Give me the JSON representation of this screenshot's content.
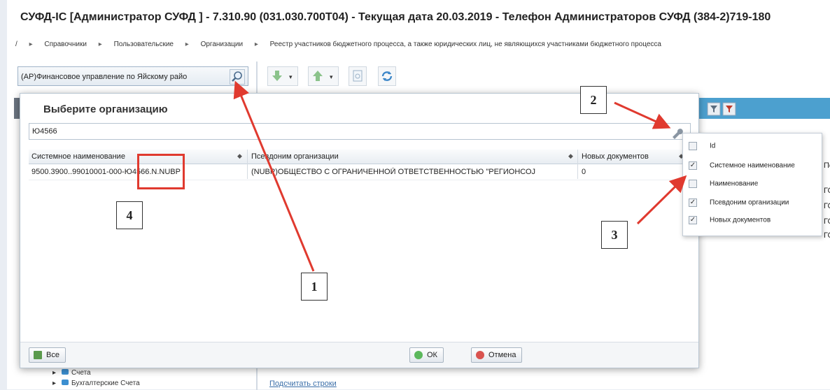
{
  "app": {
    "title": "СУФД-IC [Администратор СУФД ] - 7.310.90 (031.030.700Т04) - Текущая дата 20.03.2019 - Телефон Администраторов СУФД (384-2)719-180",
    "breadcrumb": [
      "/",
      "Справочники",
      "Пользовательские",
      "Организации",
      "Реестр участников бюджетного процесса, а также юридических лиц, не являющихся участниками бюджетного процесса"
    ],
    "org_selector_value": "(АР)Финансовое управление по Яйскому райо",
    "bottom_link": "Подсчитать строки",
    "tree_items": [
      "Счета",
      "Бухгалтерские Счета"
    ],
    "right_grid_cells": [
      "Пс",
      "ГС",
      "ГС",
      "ГС",
      "ГС"
    ]
  },
  "dialog": {
    "title": "Выберите организацию",
    "search_value": "Ю4566",
    "columns": [
      "Системное наименование",
      "Псевдоним организации",
      "Новых документов"
    ],
    "rows": [
      {
        "system_name": "9500.3900..99010001-000-Ю4566.N.NUBP",
        "alias": "(NUBP)ОБЩЕСТВО С ОГРАНИЧЕННОЙ ОТВЕТСТВЕННОСТЬЮ \"РЕГИОНСОЈ",
        "new_docs": "0"
      }
    ],
    "buttons": {
      "all": "Все",
      "ok": "ОК",
      "cancel": "Отмена"
    }
  },
  "column_menu": {
    "items": [
      {
        "label": "Id",
        "checked": false
      },
      {
        "label": "Системное наименование",
        "checked": true
      },
      {
        "label": "Наименование",
        "checked": false
      },
      {
        "label": "Псевдоним организации",
        "checked": true
      },
      {
        "label": "Новых документов",
        "checked": true
      }
    ]
  },
  "callouts": [
    "1",
    "2",
    "3",
    "4"
  ],
  "colors": {
    "accent_blue": "#4ca0cf",
    "annotation_red": "#e03a2f"
  }
}
